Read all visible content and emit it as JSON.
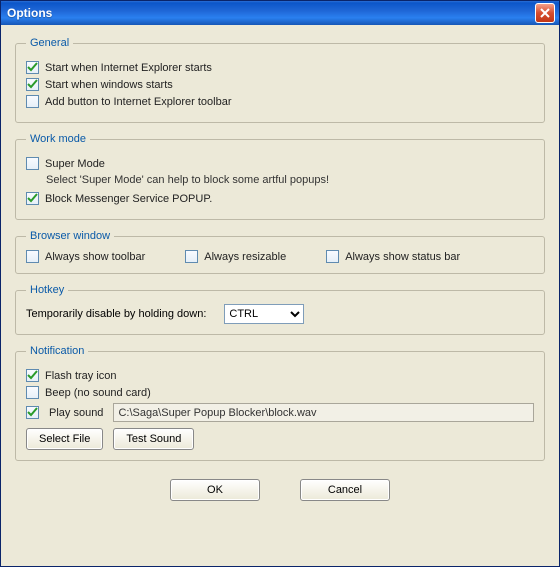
{
  "window": {
    "title": "Options"
  },
  "general": {
    "legend": "General",
    "start_ie": {
      "label": "Start when Internet Explorer starts",
      "checked": true
    },
    "start_win": {
      "label": "Start when windows starts",
      "checked": true
    },
    "add_toolbar": {
      "label": "Add button to Internet Explorer toolbar",
      "checked": false
    }
  },
  "workmode": {
    "legend": "Work mode",
    "super_mode": {
      "label": "Super Mode",
      "checked": false
    },
    "hint": "Select 'Super Mode' can help to block some artful popups!",
    "block_msgr": {
      "label": "Block Messenger Service POPUP.",
      "checked": true
    }
  },
  "browserwin": {
    "legend": "Browser window",
    "show_toolbar": {
      "label": "Always show toolbar",
      "checked": false
    },
    "resizable": {
      "label": "Always resizable",
      "checked": false
    },
    "statusbar": {
      "label": "Always show status bar",
      "checked": false
    }
  },
  "hotkey": {
    "legend": "Hotkey",
    "label": "Temporarily disable by holding down:",
    "value": "CTRL"
  },
  "notification": {
    "legend": "Notification",
    "flash_tray": {
      "label": "Flash tray icon",
      "checked": true
    },
    "beep": {
      "label": "Beep (no sound card)",
      "checked": false
    },
    "play_sound": {
      "label": "Play sound",
      "checked": true
    },
    "sound_path": "C:\\Saga\\Super Popup Blocker\\block.wav",
    "select_file": "Select File",
    "test_sound": "Test Sound"
  },
  "buttons": {
    "ok": "OK",
    "cancel": "Cancel"
  }
}
